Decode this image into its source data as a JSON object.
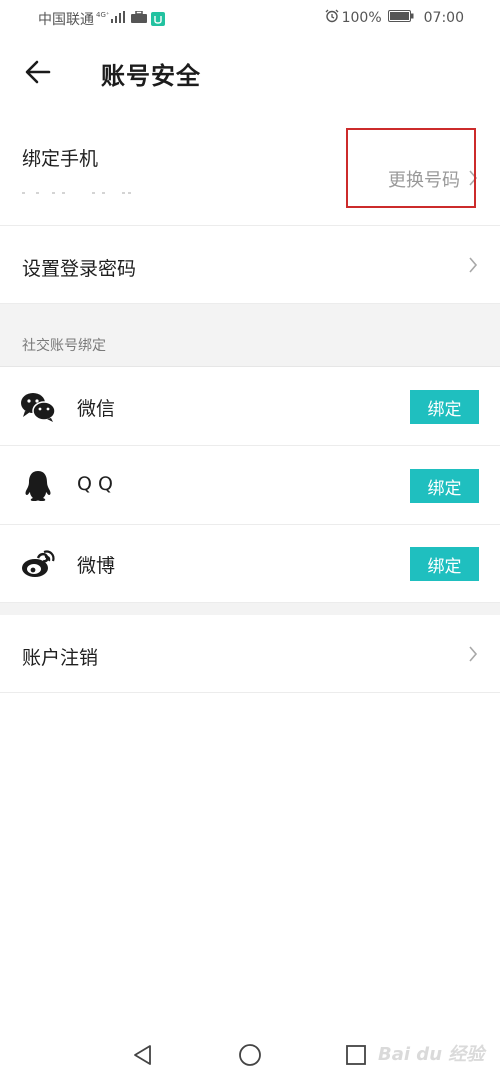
{
  "status_bar": {
    "carrier": "中国联通",
    "network_badge": "4G⁺",
    "battery_percent": "100%",
    "time": "07:00",
    "icons": [
      "signal-icon",
      "briefcase-icon",
      "app-badge-icon",
      "alarm-icon",
      "battery-icon"
    ]
  },
  "header": {
    "title": "账号安全",
    "back_icon": "arrow-left-icon"
  },
  "phone": {
    "label": "绑定手机",
    "action": "更换号码"
  },
  "password": {
    "label": "设置登录密码"
  },
  "social": {
    "section_title": "社交账号绑定",
    "items": [
      {
        "name": "微信",
        "icon": "wechat-icon",
        "button": "绑定"
      },
      {
        "name": "Q Q",
        "icon": "qq-icon",
        "button": "绑定"
      },
      {
        "name": "微博",
        "icon": "weibo-icon",
        "button": "绑定"
      }
    ]
  },
  "account": {
    "cancel_label": "账户注销"
  },
  "nav": {
    "icons": [
      "nav-back-icon",
      "nav-home-icon",
      "nav-recent-icon"
    ]
  },
  "colors": {
    "accent": "#1fbfbf",
    "highlight": "#cc2b2b",
    "section_bg": "#f3f3f3",
    "muted_text": "#9a9a9a"
  },
  "watermark": "Bai du 经验"
}
